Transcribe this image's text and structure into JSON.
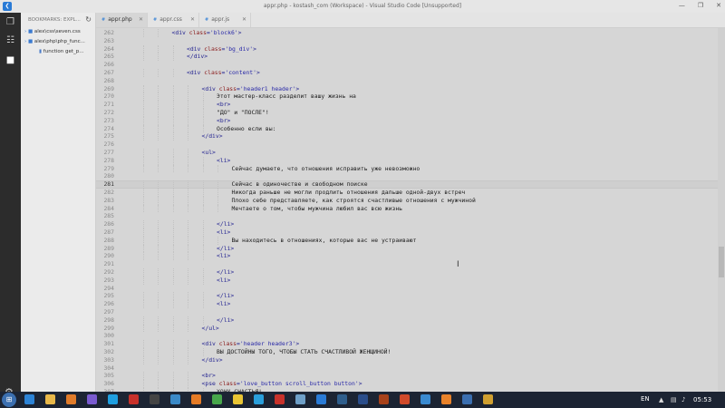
{
  "window": {
    "title": "appr.php - kostash_com (Workspace) - Visual Studio Code [Unsupported]",
    "app_icon": "vscode-icon",
    "controls": [
      "minimize",
      "restore",
      "close"
    ]
  },
  "activity_bar": {
    "items": [
      "explorer-icon",
      "files-icon",
      "bookmarks-icon"
    ],
    "settings": "gear-icon"
  },
  "sidebar": {
    "title": "BOOKMARKS: EXPL...",
    "items": [
      {
        "label": "alex\\css\\seven.css",
        "indent": 0
      },
      {
        "label": "alex\\php\\php_func...",
        "indent": 0
      },
      {
        "label": "function get_p...",
        "indent": 1
      }
    ]
  },
  "tabs": [
    {
      "label": "appr.php",
      "active": true
    },
    {
      "label": "appr.css",
      "active": false
    },
    {
      "label": "appr.js",
      "active": false
    }
  ],
  "editor": {
    "current_line": 281,
    "lines": [
      {
        "n": 262,
        "i": 3,
        "t": [
          [
            "tag",
            "<div "
          ],
          [
            "attr",
            "class"
          ],
          [
            "tag",
            "="
          ],
          [
            "str",
            "'block6'"
          ],
          [
            "tag",
            ">"
          ]
        ]
      },
      {
        "n": 263,
        "i": 0,
        "t": []
      },
      {
        "n": 264,
        "i": 4,
        "t": [
          [
            "tag",
            "<div "
          ],
          [
            "attr",
            "class"
          ],
          [
            "tag",
            "="
          ],
          [
            "str",
            "'bg_div'"
          ],
          [
            "tag",
            ">"
          ]
        ]
      },
      {
        "n": 265,
        "i": 4,
        "t": [
          [
            "tag",
            "</div>"
          ]
        ]
      },
      {
        "n": 266,
        "i": 0,
        "t": []
      },
      {
        "n": 267,
        "i": 4,
        "t": [
          [
            "tag",
            "<div "
          ],
          [
            "attr",
            "class"
          ],
          [
            "tag",
            "="
          ],
          [
            "str",
            "'content'"
          ],
          [
            "tag",
            ">"
          ]
        ]
      },
      {
        "n": 268,
        "i": 0,
        "t": []
      },
      {
        "n": 269,
        "i": 5,
        "t": [
          [
            "tag",
            "<div "
          ],
          [
            "attr",
            "class"
          ],
          [
            "tag",
            "="
          ],
          [
            "str",
            "'header1 header'"
          ],
          [
            "tag",
            ">"
          ]
        ]
      },
      {
        "n": 270,
        "i": 6,
        "t": [
          [
            "txt",
            "Этот мастер-класс разделит вашу жизнь на"
          ]
        ]
      },
      {
        "n": 271,
        "i": 6,
        "t": [
          [
            "tag",
            "<br>"
          ]
        ]
      },
      {
        "n": 272,
        "i": 6,
        "t": [
          [
            "txt",
            "\"ДО\" и \"ПОСЛЕ\"!"
          ]
        ]
      },
      {
        "n": 273,
        "i": 6,
        "t": [
          [
            "tag",
            "<br>"
          ]
        ]
      },
      {
        "n": 274,
        "i": 6,
        "t": [
          [
            "txt",
            "Особенно если вы:"
          ]
        ]
      },
      {
        "n": 275,
        "i": 5,
        "t": [
          [
            "tag",
            "</div>"
          ]
        ]
      },
      {
        "n": 276,
        "i": 0,
        "t": []
      },
      {
        "n": 277,
        "i": 5,
        "t": [
          [
            "tag",
            "<ul>"
          ]
        ]
      },
      {
        "n": 278,
        "i": 6,
        "t": [
          [
            "tag",
            "<li>"
          ]
        ]
      },
      {
        "n": 279,
        "i": 7,
        "t": [
          [
            "txt",
            "Сейчас думаете, что отношения исправить уже невозможно"
          ]
        ]
      },
      {
        "n": 280,
        "i": 0,
        "t": []
      },
      {
        "n": 281,
        "i": 7,
        "t": [
          [
            "txt",
            "Сейчас в одиночестве и свободном поиске"
          ]
        ]
      },
      {
        "n": 282,
        "i": 7,
        "t": [
          [
            "txt",
            "Никогда раньше не могли продлить отношения дальше одной-двух встреч"
          ]
        ]
      },
      {
        "n": 283,
        "i": 7,
        "t": [
          [
            "txt",
            "Плохо себе представляете, как строятся счастливые отношения с мужчиной"
          ]
        ]
      },
      {
        "n": 284,
        "i": 7,
        "t": [
          [
            "txt",
            "Мечтаете о том, чтобы мужчина любил вас всю жизнь"
          ]
        ]
      },
      {
        "n": 285,
        "i": 0,
        "t": []
      },
      {
        "n": 286,
        "i": 6,
        "t": [
          [
            "tag",
            "</li>"
          ]
        ]
      },
      {
        "n": 287,
        "i": 6,
        "t": [
          [
            "tag",
            "<li>"
          ]
        ]
      },
      {
        "n": 288,
        "i": 7,
        "t": [
          [
            "txt",
            "Вы находитесь в отношениях, которые вас не устраивают"
          ]
        ]
      },
      {
        "n": 289,
        "i": 6,
        "t": [
          [
            "tag",
            "</li>"
          ]
        ]
      },
      {
        "n": 290,
        "i": 6,
        "t": [
          [
            "tag",
            "<li>"
          ]
        ]
      },
      {
        "n": 291,
        "i": 0,
        "t": []
      },
      {
        "n": 292,
        "i": 6,
        "t": [
          [
            "tag",
            "</li>"
          ]
        ]
      },
      {
        "n": 293,
        "i": 6,
        "t": [
          [
            "tag",
            "<li>"
          ]
        ]
      },
      {
        "n": 294,
        "i": 0,
        "t": []
      },
      {
        "n": 295,
        "i": 6,
        "t": [
          [
            "tag",
            "</li>"
          ]
        ]
      },
      {
        "n": 296,
        "i": 6,
        "t": [
          [
            "tag",
            "<li>"
          ]
        ]
      },
      {
        "n": 297,
        "i": 0,
        "t": []
      },
      {
        "n": 298,
        "i": 6,
        "t": [
          [
            "tag",
            "</li>"
          ]
        ]
      },
      {
        "n": 299,
        "i": 5,
        "t": [
          [
            "tag",
            "</ul>"
          ]
        ]
      },
      {
        "n": 300,
        "i": 0,
        "t": []
      },
      {
        "n": 301,
        "i": 5,
        "t": [
          [
            "tag",
            "<div "
          ],
          [
            "attr",
            "class"
          ],
          [
            "tag",
            "="
          ],
          [
            "str",
            "'header header3'"
          ],
          [
            "tag",
            ">"
          ]
        ]
      },
      {
        "n": 302,
        "i": 6,
        "t": [
          [
            "txt",
            "ВЫ ДОСТОЙНЫ ТОГО, ЧТОБЫ СТАТЬ СЧАСТЛИВОЙ ЖЕНЩИНОЙ!"
          ]
        ]
      },
      {
        "n": 303,
        "i": 5,
        "t": [
          [
            "tag",
            "</div>"
          ]
        ]
      },
      {
        "n": 304,
        "i": 0,
        "t": []
      },
      {
        "n": 305,
        "i": 5,
        "t": [
          [
            "tag",
            "<br>"
          ]
        ]
      },
      {
        "n": 306,
        "i": 5,
        "t": [
          [
            "tag",
            "<pse "
          ],
          [
            "attr",
            "class"
          ],
          [
            "tag",
            "="
          ],
          [
            "str",
            "'love_button scroll_button button'"
          ],
          [
            "tag",
            ">"
          ]
        ]
      },
      {
        "n": 307,
        "i": 6,
        "t": [
          [
            "txt",
            "ХОЧУ СЧАСТЬЯ!"
          ]
        ]
      }
    ]
  },
  "scroll": {
    "position": 0.6,
    "thumb_size": 0.085
  },
  "taskbar": {
    "start": "windows-start-icon",
    "apps": [
      {
        "name": "ie-icon",
        "color": "#2c83d6"
      },
      {
        "name": "file-explorer-icon",
        "color": "#e8b84a"
      },
      {
        "name": "media-player-icon",
        "color": "#e07b2a"
      },
      {
        "name": "viber-icon",
        "color": "#7a5bd0"
      },
      {
        "name": "skype-icon",
        "color": "#1f9fe0"
      },
      {
        "name": "adobe-icon",
        "color": "#c8312a"
      },
      {
        "name": "terminal-icon",
        "color": "#444444"
      },
      {
        "name": "app-icon",
        "color": "#3b8ac8"
      },
      {
        "name": "firefox-icon",
        "color": "#e57b26"
      },
      {
        "name": "chrome-icon",
        "color": "#48a74b"
      },
      {
        "name": "chrome-icon",
        "color": "#e9c534"
      },
      {
        "name": "telegram-icon",
        "color": "#2a9fdb"
      },
      {
        "name": "filezilla-icon",
        "color": "#c8322b"
      },
      {
        "name": "notepad-icon",
        "color": "#6fa0c8"
      },
      {
        "name": "vscode-icon",
        "color": "#2a7bd6"
      },
      {
        "name": "vpn-icon",
        "color": "#2f5e8c"
      },
      {
        "name": "photoshop-icon",
        "color": "#2a4d8a"
      },
      {
        "name": "illustrator-icon",
        "color": "#a8421a"
      },
      {
        "name": "app-icon",
        "color": "#d04a2a"
      },
      {
        "name": "app-icon",
        "color": "#3a8ad0"
      },
      {
        "name": "vlc-icon",
        "color": "#e8822a"
      },
      {
        "name": "app-icon",
        "color": "#3b6fb0"
      },
      {
        "name": "app-icon",
        "color": "#d0a030"
      }
    ],
    "lang": "EN",
    "clock": "05:53"
  }
}
